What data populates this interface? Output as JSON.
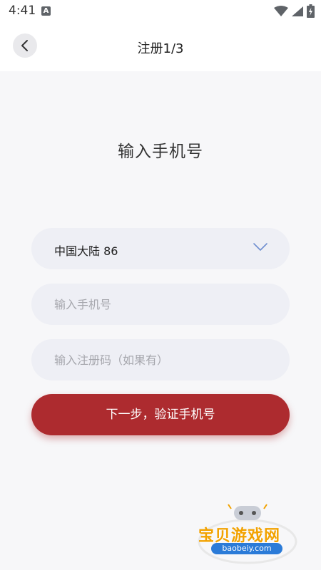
{
  "status_bar": {
    "time": "4:41",
    "notification_icon": "a-icon",
    "icons": [
      "wifi-icon",
      "signal-icon",
      "battery-icon"
    ]
  },
  "header": {
    "back_icon": "chevron-left-icon",
    "title": "注册1/3"
  },
  "main": {
    "heading": "输入手机号",
    "region": {
      "selected_value": "中国大陆 86",
      "icon": "chevron-down-icon"
    },
    "phone_input": {
      "value": "",
      "placeholder": "输入手机号"
    },
    "invite_code_input": {
      "value": "",
      "placeholder": "输入注册码（如果有）"
    },
    "next_button_label": "下一步，验证手机号"
  },
  "watermark": {
    "name": "宝贝游戏网",
    "url": "baobeiy.com"
  },
  "colors": {
    "primary": "#ad2b2f",
    "field_background": "#eeeff5",
    "background": "#f7f7f9",
    "chevron": "#6f8fd0"
  }
}
